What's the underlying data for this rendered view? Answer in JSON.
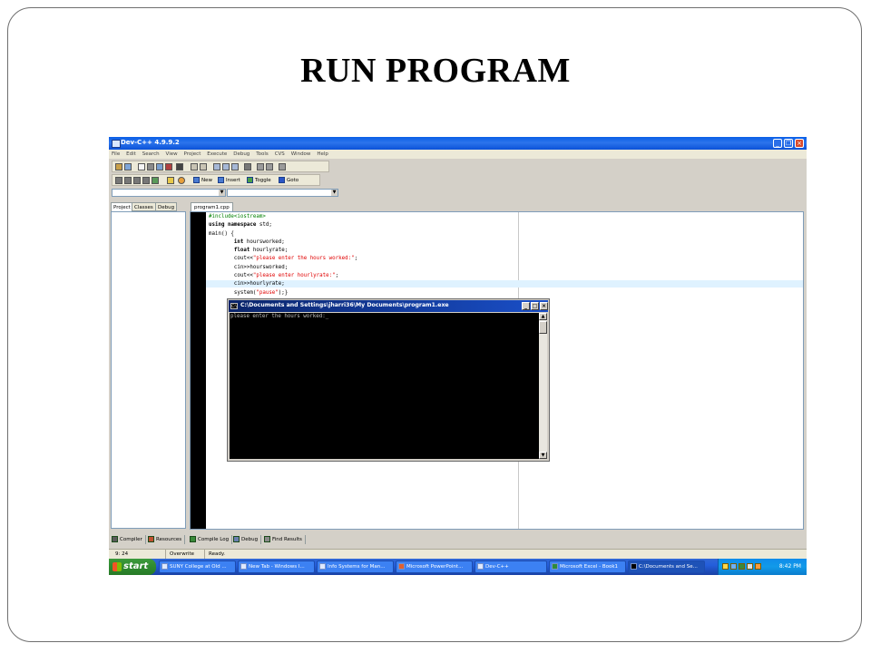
{
  "slide": {
    "title": "RUN PROGRAM"
  },
  "ide": {
    "window_title": "Dev-C++ 4.9.9.2",
    "menu": [
      "File",
      "Edit",
      "Search",
      "View",
      "Project",
      "Execute",
      "Debug",
      "Tools",
      "CVS",
      "Window",
      "Help"
    ],
    "toolbar_buttons": {
      "new": "New",
      "insert": "Insert",
      "toggle": "Toggle",
      "goto": "Goto"
    },
    "left_tabs": [
      "Project",
      "Classes",
      "Debug"
    ],
    "editor_tab": "program1.cpp",
    "code_lines": [
      "#include<iostream>",
      "using namespace std;",
      "main() {",
      "        int hoursworked;",
      "        float hourlyrate;",
      "        cout<<\"please enter the hours worked:\";",
      "        cin>>hoursworked;",
      "        cout<<\"please enter hourlyrate:\";",
      "        cin>>hourlyrate;",
      "        system(\"pause\");}"
    ],
    "bottom_tabs": [
      "Compiler",
      "Resources",
      "Compile Log",
      "Debug",
      "Find Results"
    ],
    "status": {
      "position": "9: 24",
      "mode": "Overwrite",
      "state": "Ready."
    }
  },
  "console": {
    "title": "C:\\Documents and Settings\\jharri36\\My Documents\\program1.exe",
    "output": "please enter the hours worked:_"
  },
  "taskbar": {
    "start_label": "start",
    "tasks": [
      "SUNY College at Old ...",
      "New Tab - Windows I...",
      "Info Systems for Man...",
      "Microsoft PowerPoint...",
      "Dev-C++",
      "Microsoft Excel - Book1",
      "C:\\Documents and Se..."
    ],
    "clock": "8:42 PM"
  },
  "colors": {
    "xp_blue": "#0a5fe6",
    "start_green": "#2f8a2f",
    "code_string": "#e00000",
    "code_preprocessor": "#008000"
  }
}
